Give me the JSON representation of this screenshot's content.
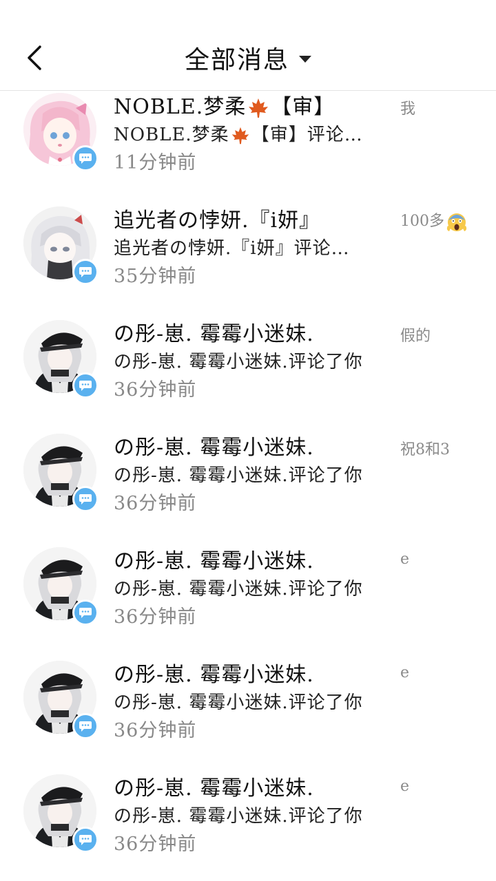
{
  "header": {
    "title": "全部消息"
  },
  "messages": [
    {
      "name_pre": "NOBLE.梦柔",
      "name_post": "【审】",
      "name_icon": "maple-leaf-icon",
      "preview_pre": "NOBLE.梦柔",
      "preview_post": "【审】评论…",
      "preview_icon": "maple-leaf-icon",
      "time": "11分钟前",
      "snippet": "我",
      "avatar": "pink-anime-girl"
    },
    {
      "name": "追光者の悖妍.『i妍』",
      "preview": "追光者の悖妍.『i妍』评论…",
      "time": "35分钟前",
      "snippet": "100多",
      "snippet_icon": "screaming-face-icon",
      "avatar": "white-hair-girl"
    },
    {
      "name": "の彤-崽. 霉霉小迷妹.",
      "preview": "の彤-崽. 霉霉小迷妹.评论了你",
      "time": "36分钟前",
      "snippet": "假的",
      "avatar": "dark-cap-girl"
    },
    {
      "name": "の彤-崽. 霉霉小迷妹.",
      "preview": "の彤-崽. 霉霉小迷妹.评论了你",
      "time": "36分钟前",
      "snippet": "祝8和3",
      "avatar": "dark-cap-girl"
    },
    {
      "name": "の彤-崽. 霉霉小迷妹.",
      "preview": "の彤-崽. 霉霉小迷妹.评论了你",
      "time": "36分钟前",
      "snippet": "e",
      "avatar": "dark-cap-girl"
    },
    {
      "name": "の彤-崽. 霉霉小迷妹.",
      "preview": "の彤-崽. 霉霉小迷妹.评论了你",
      "time": "36分钟前",
      "snippet": "e",
      "avatar": "dark-cap-girl"
    },
    {
      "name": "の彤-崽. 霉霉小迷妹.",
      "preview": "の彤-崽. 霉霉小迷妹.评论了你",
      "time": "36分钟前",
      "snippet": "e",
      "avatar": "dark-cap-girl"
    }
  ],
  "colors": {
    "badge": "#5ab1ef",
    "time": "#888888",
    "snippet": "#8a8a8a",
    "divider": "#e3e3e3"
  }
}
